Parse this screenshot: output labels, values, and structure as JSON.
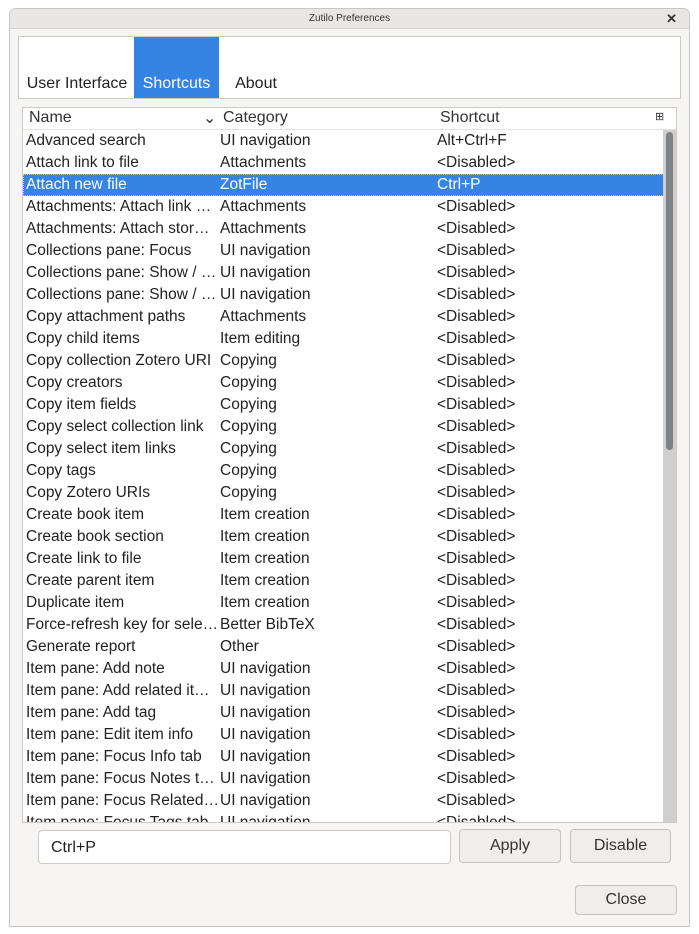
{
  "window": {
    "title": "Zutilo Preferences",
    "close_icon": "close-icon"
  },
  "tabs": [
    {
      "label": "User Interface"
    },
    {
      "label": "Shortcuts",
      "active": true
    },
    {
      "label": "About"
    }
  ],
  "tree": {
    "columns": [
      "Name",
      "Category",
      "Shortcut"
    ],
    "sort_icon": "chevron-down-icon",
    "column_picker_icon": "column-picker-icon",
    "selected_color": "#3584e4",
    "rows": [
      [
        "Advanced search",
        "UI navigation",
        "Alt+Ctrl+F"
      ],
      [
        "Attach link to file",
        "Attachments",
        "<Disabled>"
      ],
      [
        "Attach new file",
        "ZotFile",
        "Ctrl+P"
      ],
      [
        "Attachments: Attach link …",
        "Attachments",
        "<Disabled>"
      ],
      [
        "Attachments: Attach stor…",
        "Attachments",
        "<Disabled>"
      ],
      [
        "Collections pane: Focus",
        "UI navigation",
        "<Disabled>"
      ],
      [
        "Collections pane: Show / …",
        "UI navigation",
        "<Disabled>"
      ],
      [
        "Collections pane: Show / …",
        "UI navigation",
        "<Disabled>"
      ],
      [
        "Copy attachment paths",
        "Attachments",
        "<Disabled>"
      ],
      [
        "Copy child items",
        "Item editing",
        "<Disabled>"
      ],
      [
        "Copy collection Zotero URI",
        "Copying",
        "<Disabled>"
      ],
      [
        "Copy creators",
        "Copying",
        "<Disabled>"
      ],
      [
        "Copy item fields",
        "Copying",
        "<Disabled>"
      ],
      [
        "Copy select collection link",
        "Copying",
        "<Disabled>"
      ],
      [
        "Copy select item links",
        "Copying",
        "<Disabled>"
      ],
      [
        "Copy tags",
        "Copying",
        "<Disabled>"
      ],
      [
        "Copy Zotero URIs",
        "Copying",
        "<Disabled>"
      ],
      [
        "Create book item",
        "Item creation",
        "<Disabled>"
      ],
      [
        "Create book section",
        "Item creation",
        "<Disabled>"
      ],
      [
        "Create link to file",
        "Item creation",
        "<Disabled>"
      ],
      [
        "Create parent item",
        "Item creation",
        "<Disabled>"
      ],
      [
        "Duplicate item",
        "Item creation",
        "<Disabled>"
      ],
      [
        "Force-refresh key for sele…",
        "Better BibTeX",
        "<Disabled>"
      ],
      [
        "Generate report",
        "Other",
        "<Disabled>"
      ],
      [
        "Item pane: Add note",
        "UI navigation",
        "<Disabled>"
      ],
      [
        "Item pane: Add related it…",
        "UI navigation",
        "<Disabled>"
      ],
      [
        "Item pane: Add tag",
        "UI navigation",
        "<Disabled>"
      ],
      [
        "Item pane: Edit item info",
        "UI navigation",
        "<Disabled>"
      ],
      [
        "Item pane: Focus Info tab",
        "UI navigation",
        "<Disabled>"
      ],
      [
        "Item pane: Focus Notes t…",
        "UI navigation",
        "<Disabled>"
      ],
      [
        "Item pane: Focus Related…",
        "UI navigation",
        "<Disabled>"
      ],
      [
        "Item pane: Focus Tags tab",
        "UI navigation",
        "<Disabled>"
      ]
    ],
    "selected_index": 2
  },
  "shortcut_input": {
    "value": "Ctrl+P"
  },
  "buttons": {
    "apply": "Apply",
    "disable": "Disable",
    "close": "Close"
  }
}
